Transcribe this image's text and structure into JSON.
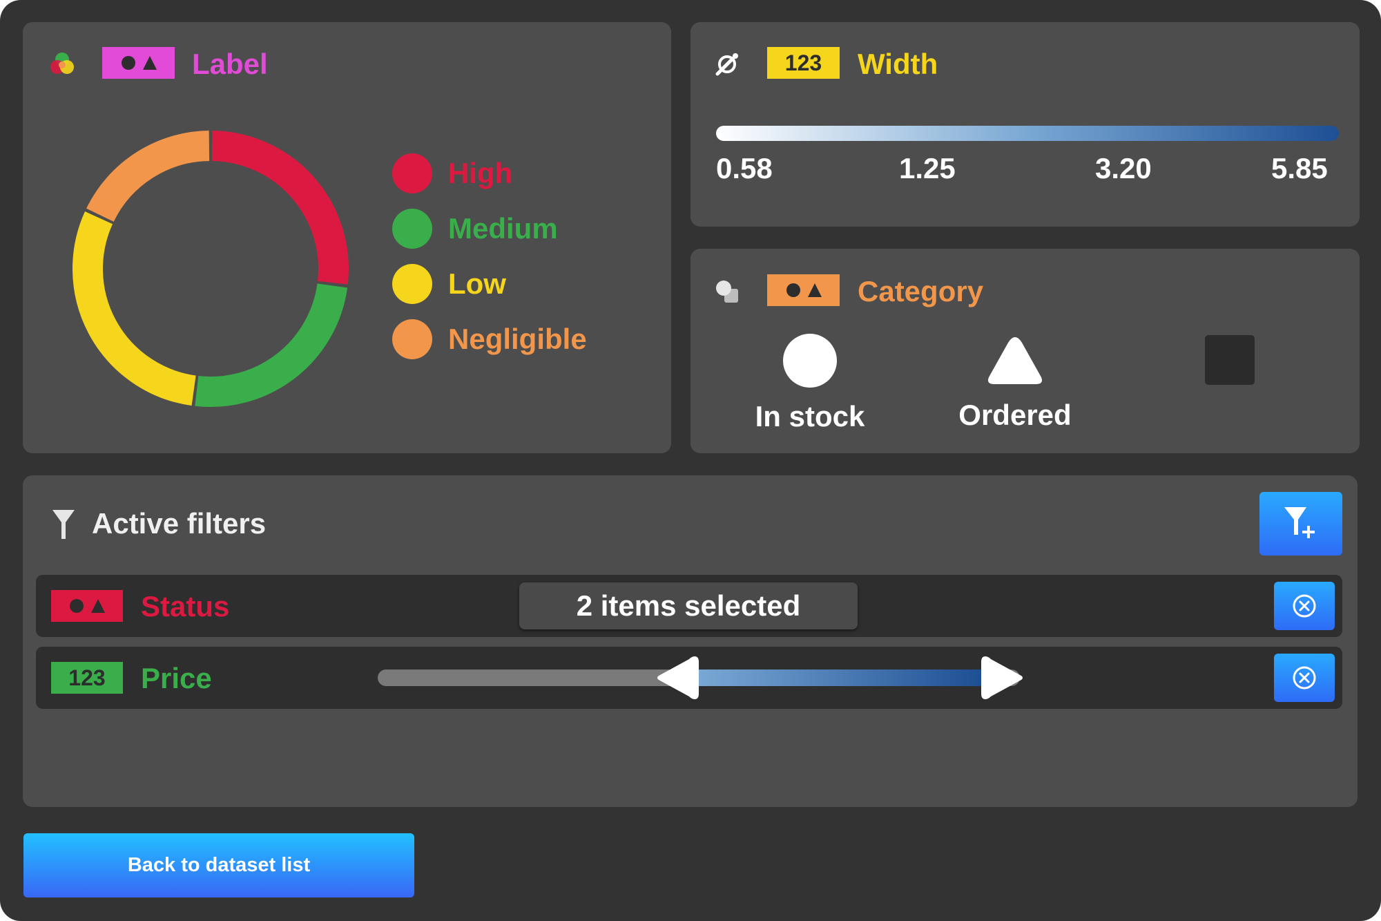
{
  "label_panel": {
    "title": "Label",
    "title_color": "#e24ad8",
    "tag_color": "#e24ad8",
    "icon": "color-circles-icon",
    "tag_icon": "shapes-icon",
    "legend": [
      {
        "label": "High",
        "color": "#dc1a41"
      },
      {
        "label": "Medium",
        "color": "#3aae4a"
      },
      {
        "label": "Low",
        "color": "#f6d61c"
      },
      {
        "label": "Negligible",
        "color": "#f1964a"
      }
    ],
    "donut_shares": [
      0.27,
      0.25,
      0.3,
      0.18
    ]
  },
  "width_panel": {
    "title": "Width",
    "title_color": "#f6d61c",
    "tag_text": "123",
    "icon": "pipette-icon",
    "gradient": [
      "#ffffff",
      "#7aa8d4",
      "#1e4f94"
    ],
    "ticks": [
      "0.58",
      "1.25",
      "3.20",
      "5.85"
    ]
  },
  "category_panel": {
    "title": "Category",
    "title_color": "#f1964a",
    "icon": "shapes-stack-icon",
    "tag_icon": "shapes-icon",
    "items": [
      {
        "shape": "circle-icon",
        "label": "In stock"
      },
      {
        "shape": "triangle-icon",
        "label": "Ordered"
      },
      {
        "shape": "square-icon",
        "label": ""
      }
    ]
  },
  "filters": {
    "title": "Active filters",
    "filter_icon": "funnel-icon",
    "add_icon": "add-filter-icon",
    "rows": [
      {
        "name": "Status",
        "color": "#dc1a41",
        "tag_icon": "shapes-icon",
        "value": "2 items selected"
      },
      {
        "name": "Price",
        "color": "#3aae4a",
        "tag_text": "123",
        "range_low": 0.5,
        "range_high": 0.94
      }
    ]
  },
  "back_button": {
    "label": "Back to dataset list"
  }
}
